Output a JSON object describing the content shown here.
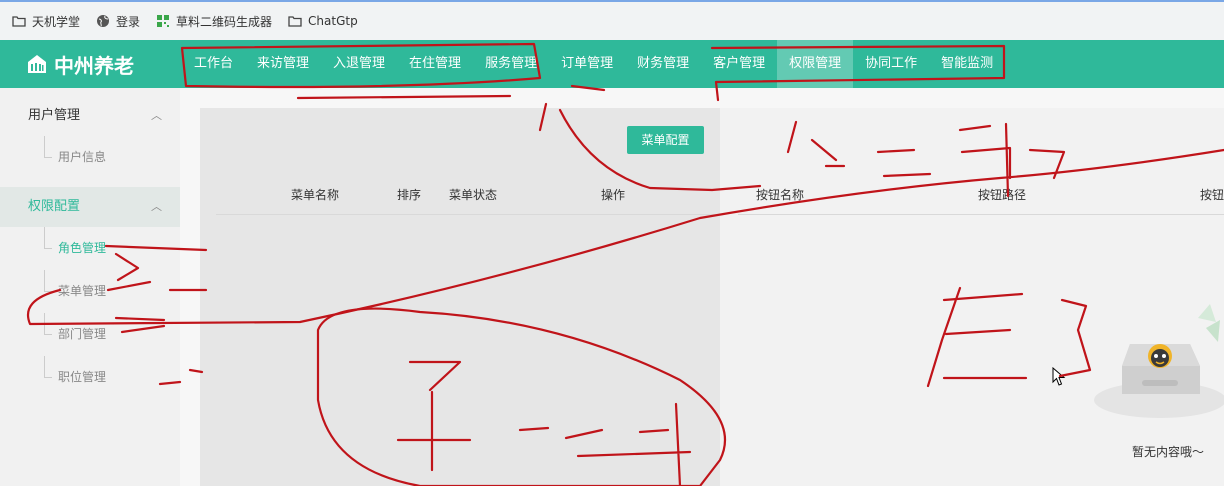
{
  "bookmarks": [
    {
      "label": "天机学堂",
      "icon": "folder-icon"
    },
    {
      "label": "登录",
      "icon": "globe-icon"
    },
    {
      "label": "草料二维码生成器",
      "icon": "qrcode-icon"
    },
    {
      "label": "ChatGtp",
      "icon": "folder-icon"
    }
  ],
  "header": {
    "logo_text": "中州养老",
    "logo_icon": "building-icon",
    "nav": [
      "工作台",
      "来访管理",
      "入退管理",
      "在住管理",
      "服务管理",
      "订单管理",
      "财务管理",
      "客户管理",
      "权限管理",
      "协同工作",
      "智能监测"
    ],
    "active_nav": "权限管理"
  },
  "sidebar": {
    "group1": {
      "label": "用户管理",
      "chevron": "chevron-up-icon"
    },
    "group1_items": [
      "用户信息"
    ],
    "group2": {
      "label": "权限配置",
      "chevron": "chevron-up-icon"
    },
    "group2_items": [
      "角色管理",
      "菜单管理",
      "部门管理",
      "职位管理"
    ],
    "active_item": "角色管理"
  },
  "menu_table": {
    "button_label": "菜单配置",
    "columns": [
      "菜单名称",
      "排序",
      "菜单状态",
      "操作"
    ]
  },
  "button_table": {
    "columns": [
      "按钮名称",
      "按钮路径",
      "按钮"
    ]
  },
  "empty_state": {
    "text": "暂无内容哦～"
  },
  "colors": {
    "accent": "#2fb99a",
    "annotation": "#c0141a"
  }
}
